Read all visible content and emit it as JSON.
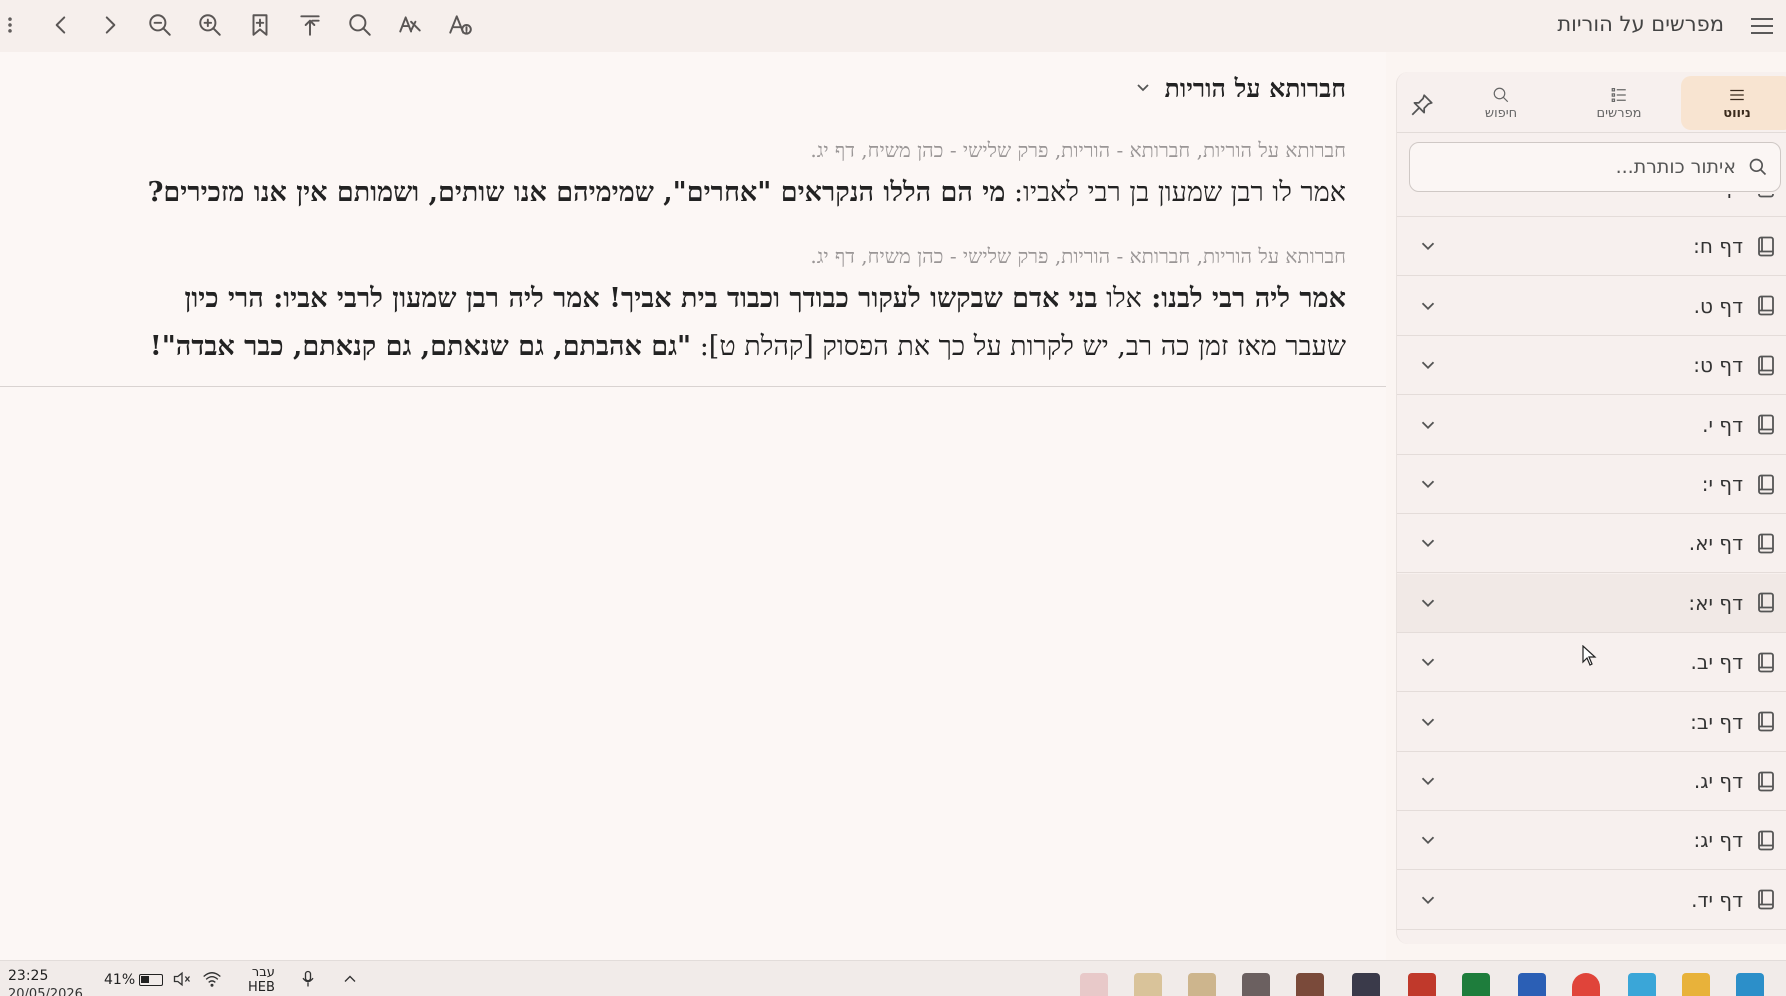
{
  "toolbar": {
    "title": "מפרשים על הוריות",
    "icons": [
      "more-vert-icon",
      "back-icon",
      "forward-icon",
      "zoom-out-icon",
      "zoom-in-icon",
      "add-bookmark-icon",
      "jump-top-icon",
      "search-icon",
      "nikud-icon",
      "text-format-icon",
      "menu-icon"
    ]
  },
  "content": {
    "commentator_title": "חברותא על הוריות",
    "entries": [
      {
        "ref": "חברותא על הוריות, חברותא - הוריות, פרק שלישי - כהן משיח, דף יג.",
        "body_pre": "אמר לו רבן שמעון בן רבי לאביו: ",
        "body_bold": "מי הם הללו הנקראים \"אחרים\", שמימיהם אנו שותים, ושמותם אין אנו מזכירים?"
      },
      {
        "ref": "חברותא על הוריות, חברותא - הוריות, פרק שלישי - כהן משיח, דף יג.",
        "body_bold1": "אמר ליה רבי לבנו: ",
        "body_plain1": "אלו ",
        "body_bold2": "בני אדם שבקשו לעקור כבודך וכבוד בית אביך! ",
        "body_bold3": "אמר ליה רבן שמעון לרבי אביו: הרי כיון",
        "body_line2_plain": "שעבר מאז זמן כה רב, יש לקרות על כך את הפסוק [קהלת ט]: ",
        "body_line2_bold": "\"גם אהבתם, גם שנאתם, גם קנאתם, כבר אבדה\"!"
      }
    ]
  },
  "side_panel": {
    "tabs": [
      {
        "name": "navigation",
        "label": "ניווט",
        "icon": "list-icon",
        "active": true
      },
      {
        "name": "commentators",
        "label": "מפרשים",
        "icon": "bulleted-list-icon",
        "active": false
      },
      {
        "name": "search",
        "label": "חיפוש",
        "icon": "search-icon",
        "active": false
      }
    ],
    "search_placeholder": "איתור כותרת...",
    "items": [
      {
        "label": "דף ז:"
      },
      {
        "label": "דף ח:"
      },
      {
        "label": "דף ט."
      },
      {
        "label": "דף ט:"
      },
      {
        "label": "דף י."
      },
      {
        "label": "דף י:"
      },
      {
        "label": "דף יא."
      },
      {
        "label": "דף יא:"
      },
      {
        "label": "דף יב."
      },
      {
        "label": "דף יב:"
      },
      {
        "label": "דף יג."
      },
      {
        "label": "דף יג:"
      },
      {
        "label": "דף יד."
      }
    ]
  },
  "taskbar": {
    "time": "23:25",
    "date": "20/05/2026",
    "battery": "41%",
    "language": "עבר",
    "language_sub": "HEB"
  },
  "colors": {
    "background": "#fbf5f2",
    "active_tab": "#f8e4d1",
    "reference_text": "#9a9696"
  }
}
